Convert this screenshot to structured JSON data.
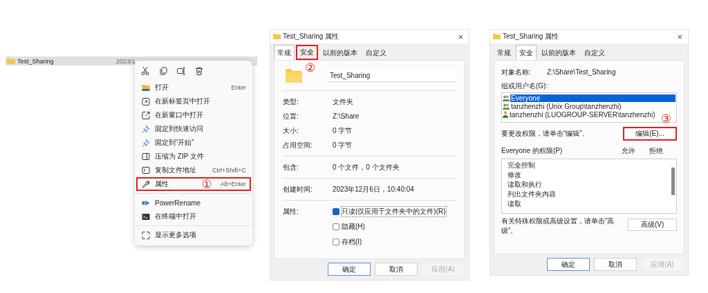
{
  "explorer_row": {
    "name": "Test_Sharing",
    "date": "2023/1",
    "selected": true
  },
  "context_menu": {
    "sections": [
      [
        {
          "kind": "folder",
          "label": "打开",
          "shortcut": "Enter",
          "highlighted": false
        },
        {
          "kind": "newtab",
          "label": "在新标签页中打开",
          "highlighted": false
        },
        {
          "kind": "newwindow",
          "label": "在新窗口中打开",
          "highlighted": false
        },
        {
          "kind": "pin",
          "label": "固定到快速访问",
          "highlighted": false
        },
        {
          "kind": "pin",
          "label": "固定到“开始”",
          "highlighted": false
        },
        {
          "kind": "zip",
          "label": "压缩为 ZIP 文件",
          "highlighted": false
        },
        {
          "kind": "path",
          "label": "复制文件地址",
          "shortcut": "Ctrl+Shift+C",
          "highlighted": false
        },
        {
          "kind": "wrench",
          "label": "属性",
          "shortcut": "Alt+Enter",
          "highlighted": true,
          "marker": "①"
        }
      ],
      [
        {
          "kind": "rename",
          "label": "PowerRename",
          "highlighted": false
        },
        {
          "kind": "terminal",
          "label": "在终端中打开",
          "highlighted": false
        }
      ],
      [
        {
          "kind": "more",
          "label": "显示更多选项",
          "highlighted": false
        }
      ]
    ]
  },
  "properties_dialog": {
    "title": "Test_Sharing 属性",
    "close": "×",
    "tabs": [
      {
        "label": "常规",
        "selected": true,
        "highlighted": false
      },
      {
        "label": "安全",
        "selected": false,
        "highlighted": true,
        "marker": "②"
      },
      {
        "label": "以前的版本",
        "selected": false,
        "highlighted": false
      },
      {
        "label": "自定义",
        "selected": false,
        "highlighted": false
      }
    ],
    "name": "Test_Sharing",
    "groups": [
      [
        {
          "label": "类型:",
          "value": "文件夹"
        },
        {
          "label": "位置:",
          "value": "Z:\\Share"
        },
        {
          "label": "大小:",
          "value": "0 字节"
        },
        {
          "label": "占用空间:",
          "value": "0 字节"
        }
      ],
      [
        {
          "label": "包含:",
          "value": "0 个文件，0 个文件夹"
        }
      ],
      [
        {
          "label": "创建时间:",
          "value": "2023年12月6日，10:40:04"
        }
      ]
    ],
    "attributes_label": "属性:",
    "attributes": [
      {
        "label": "只读(仅应用于文件夹中的文件)(R)",
        "checked": true
      },
      {
        "label": "隐藏(H)",
        "checked": false
      },
      {
        "label": "存档(I)",
        "checked": false
      }
    ],
    "buttons": [
      {
        "label": "确定",
        "default": true,
        "disabled": false
      },
      {
        "label": "取消",
        "default": false,
        "disabled": false
      },
      {
        "label": "应用(A)",
        "default": false,
        "disabled": true
      }
    ]
  },
  "security_dialog": {
    "title": "Test_Sharing 属性",
    "close": "×",
    "tabs": [
      {
        "label": "常规",
        "selected": false
      },
      {
        "label": "安全",
        "selected": true
      },
      {
        "label": "以前的版本",
        "selected": false
      },
      {
        "label": "自定义",
        "selected": false
      }
    ],
    "object_label": "对象名称:",
    "object_value": "Z:\\Share\\Test_Sharing",
    "users_label": "组或用户名(G):",
    "users": [
      {
        "kind": "group",
        "name": "Everyone",
        "selected": true
      },
      {
        "kind": "group",
        "name": "tanzhenzhi (Unix Group\\tanzhenzhi)",
        "selected": false
      },
      {
        "kind": "user",
        "name": "tanzhenzhi (LUOGROUP-SERVER\\tanzhenzhi)",
        "selected": false
      }
    ],
    "edit_hint": "要更改权限，请单击“编辑”。",
    "edit_button": {
      "label": "编辑(E)...",
      "highlighted": true,
      "marker": "③"
    },
    "permissions_label": "Everyone 的权限(P)",
    "allow": "允许",
    "deny": "拒绝",
    "permissions": [
      "完全控制",
      "修改",
      "读取和执行",
      "列出文件夹内容",
      "读取"
    ],
    "advanced_hint": "有关特殊权限或高级设置，请单击“高级”。",
    "advanced_button": "高级(V)",
    "buttons": [
      {
        "label": "确定",
        "default": true,
        "disabled": false
      },
      {
        "label": "取消",
        "default": false,
        "disabled": false
      },
      {
        "label": "应用(A)",
        "default": false,
        "disabled": true
      }
    ]
  }
}
